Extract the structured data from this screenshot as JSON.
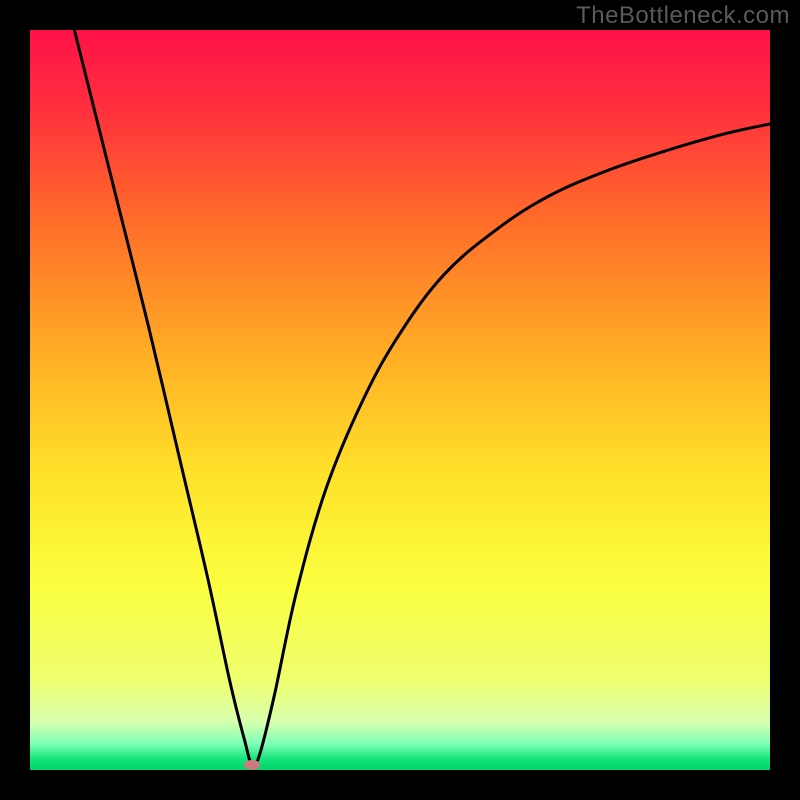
{
  "watermark": "TheBottleneck.com",
  "chart_data": {
    "type": "line",
    "title": "",
    "xlabel": "",
    "ylabel": "",
    "xlim": [
      0,
      100
    ],
    "ylim": [
      0,
      100
    ],
    "gradient_stops": [
      {
        "pos": 0.0,
        "color": "#ff1249"
      },
      {
        "pos": 0.1,
        "color": "#ff2e3e"
      },
      {
        "pos": 0.25,
        "color": "#ff6a2a"
      },
      {
        "pos": 0.45,
        "color": "#ffb225"
      },
      {
        "pos": 0.6,
        "color": "#ffe22a"
      },
      {
        "pos": 0.75,
        "color": "#fbff40"
      },
      {
        "pos": 0.88,
        "color": "#efff70"
      },
      {
        "pos": 0.935,
        "color": "#d7ffaf"
      },
      {
        "pos": 0.965,
        "color": "#7dffb7"
      },
      {
        "pos": 0.985,
        "color": "#14e47a"
      },
      {
        "pos": 1.0,
        "color": "#00d368"
      }
    ],
    "curve": {
      "minimum_x": 30,
      "points": [
        {
          "x": 6,
          "y": 100
        },
        {
          "x": 8,
          "y": 92
        },
        {
          "x": 12,
          "y": 76
        },
        {
          "x": 16,
          "y": 60
        },
        {
          "x": 20,
          "y": 43
        },
        {
          "x": 24,
          "y": 26
        },
        {
          "x": 27,
          "y": 12
        },
        {
          "x": 29,
          "y": 4
        },
        {
          "x": 30,
          "y": 0.7
        },
        {
          "x": 31,
          "y": 2
        },
        {
          "x": 33,
          "y": 10
        },
        {
          "x": 36,
          "y": 24
        },
        {
          "x": 40,
          "y": 38
        },
        {
          "x": 45,
          "y": 50
        },
        {
          "x": 50,
          "y": 59
        },
        {
          "x": 56,
          "y": 67
        },
        {
          "x": 63,
          "y": 73
        },
        {
          "x": 70,
          "y": 77.5
        },
        {
          "x": 78,
          "y": 81
        },
        {
          "x": 86,
          "y": 83.7
        },
        {
          "x": 94,
          "y": 86
        },
        {
          "x": 100,
          "y": 87.3
        }
      ]
    },
    "marker": {
      "x": 30,
      "y": 0.7,
      "color": "#cc7a7e",
      "rx": 8,
      "ry": 5
    }
  },
  "layout": {
    "outer_border": 30,
    "plot_size": 740
  }
}
